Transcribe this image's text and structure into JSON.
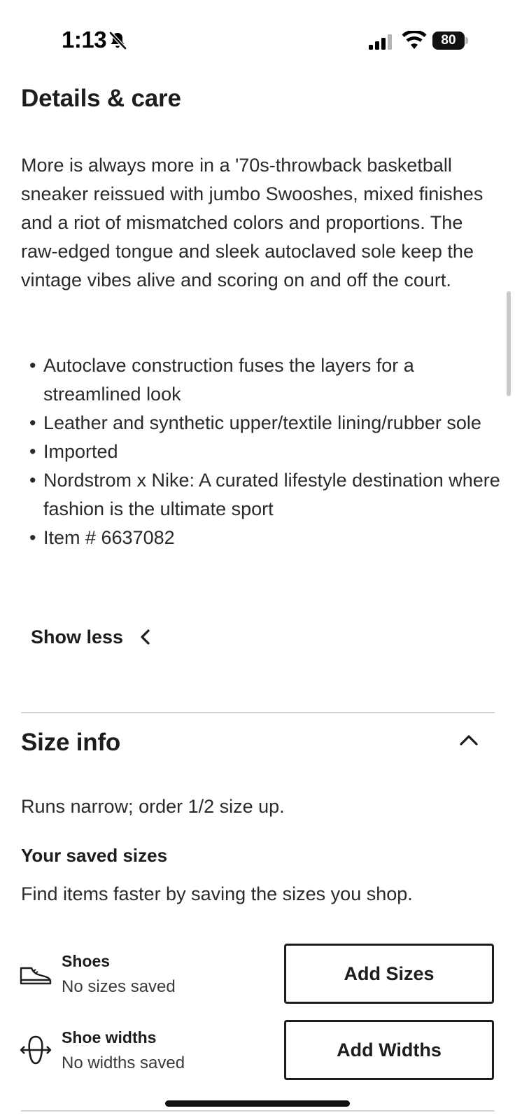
{
  "status_bar": {
    "time": "1:13",
    "battery": "80"
  },
  "details": {
    "title": "Details & care",
    "description": "More is always more in a '70s-throwback basketball sneaker reissued with jumbo Swooshes, mixed finishes and a riot of mismatched colors and proportions. The raw-edged tongue and sleek autoclaved sole keep the vintage vibes alive and scoring on and off the court.",
    "bullets": [
      "Autoclave construction fuses the layers for a streamlined look",
      "Leather and synthetic upper/textile lining/rubber sole",
      "Imported",
      "Nordstrom x Nike: A curated lifestyle destination where fashion is the ultimate sport",
      "Item # 6637082"
    ],
    "show_less_label": "Show less"
  },
  "size_info": {
    "title": "Size info",
    "fit_note": "Runs narrow; order 1/2 size up.",
    "saved_sizes_title": "Your saved sizes",
    "saved_sizes_description": "Find items faster by saving the sizes you shop.",
    "rows": [
      {
        "icon": "shoe-icon",
        "name": "Shoes",
        "status": "No sizes saved",
        "button_label": "Add Sizes"
      },
      {
        "icon": "shoe-width-icon",
        "name": "Shoe widths",
        "status": "No widths saved",
        "button_label": "Add Widths"
      }
    ]
  }
}
